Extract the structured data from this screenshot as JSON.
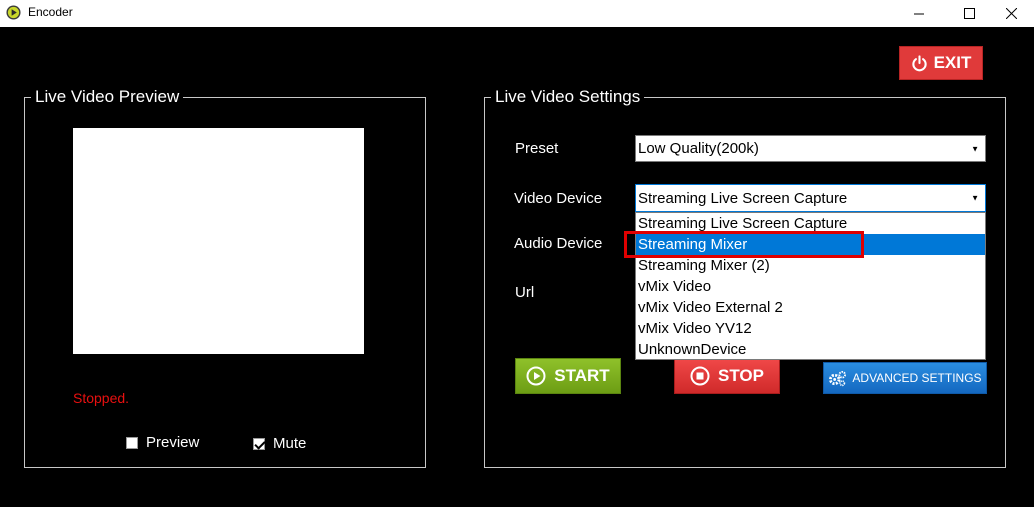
{
  "window": {
    "title": "Encoder"
  },
  "toolbar": {
    "exit_label": "EXIT"
  },
  "preview_group": {
    "title": "Live Video Preview",
    "status": "Stopped.",
    "preview_label": "Preview",
    "preview_checked": false,
    "mute_label": "Mute",
    "mute_checked": true
  },
  "settings_group": {
    "title": "Live Video Settings",
    "preset_label": "Preset",
    "preset_value": "Low Quality(200k)",
    "video_device_label": "Video Device",
    "video_device_value": "Streaming Live Screen Capture",
    "audio_device_label": "Audio Device",
    "url_label": "Url",
    "video_device_options": [
      "Streaming Live Screen Capture",
      "Streaming Mixer",
      "Streaming Mixer (2)",
      "vMix Video",
      "vMix Video External 2",
      "vMix Video YV12",
      "UnknownDevice"
    ],
    "highlighted_option": "Streaming Mixer"
  },
  "actions": {
    "start_label": "START",
    "stop_label": "STOP",
    "advanced_label": "ADVANCED SETTINGS"
  },
  "colors": {
    "exit": "#e03a3a",
    "start": "#7fae1e",
    "stop": "#e03a3a",
    "advanced": "#1e7ad0",
    "status_text": "#e81010",
    "selection": "#0078d7",
    "callout": "#e00000"
  },
  "icons": {
    "app": "play-circle-icon",
    "exit": "power-icon",
    "start": "play-circle-icon",
    "stop": "stop-circle-icon",
    "advanced": "gears-icon"
  }
}
